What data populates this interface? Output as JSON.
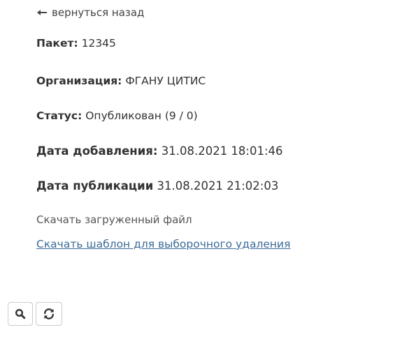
{
  "back_link": {
    "label": "вернуться назад",
    "icon": "arrow-left-icon"
  },
  "package": {
    "label": "Пакет:",
    "value": "12345"
  },
  "organization": {
    "label": "Организация:",
    "value": "ФГАНУ ЦИТИС"
  },
  "status": {
    "label": "Статус:",
    "value": "Опубликован (9 / 0)"
  },
  "date_added": {
    "label": "Дата добавления:",
    "value": "31.08.2021 18:01:46"
  },
  "date_published": {
    "label": "Дата публикации",
    "value": "31.08.2021 21:02:03"
  },
  "links": {
    "download_uploaded": "Скачать загруженный файл",
    "download_template": "Скачать шаблон для выборочного удаления"
  },
  "toolbar": {
    "search_icon": "search-icon",
    "refresh_icon": "refresh-icon"
  },
  "colors": {
    "text": "#333333",
    "link": "#3a6a98",
    "border": "#cccccc"
  }
}
